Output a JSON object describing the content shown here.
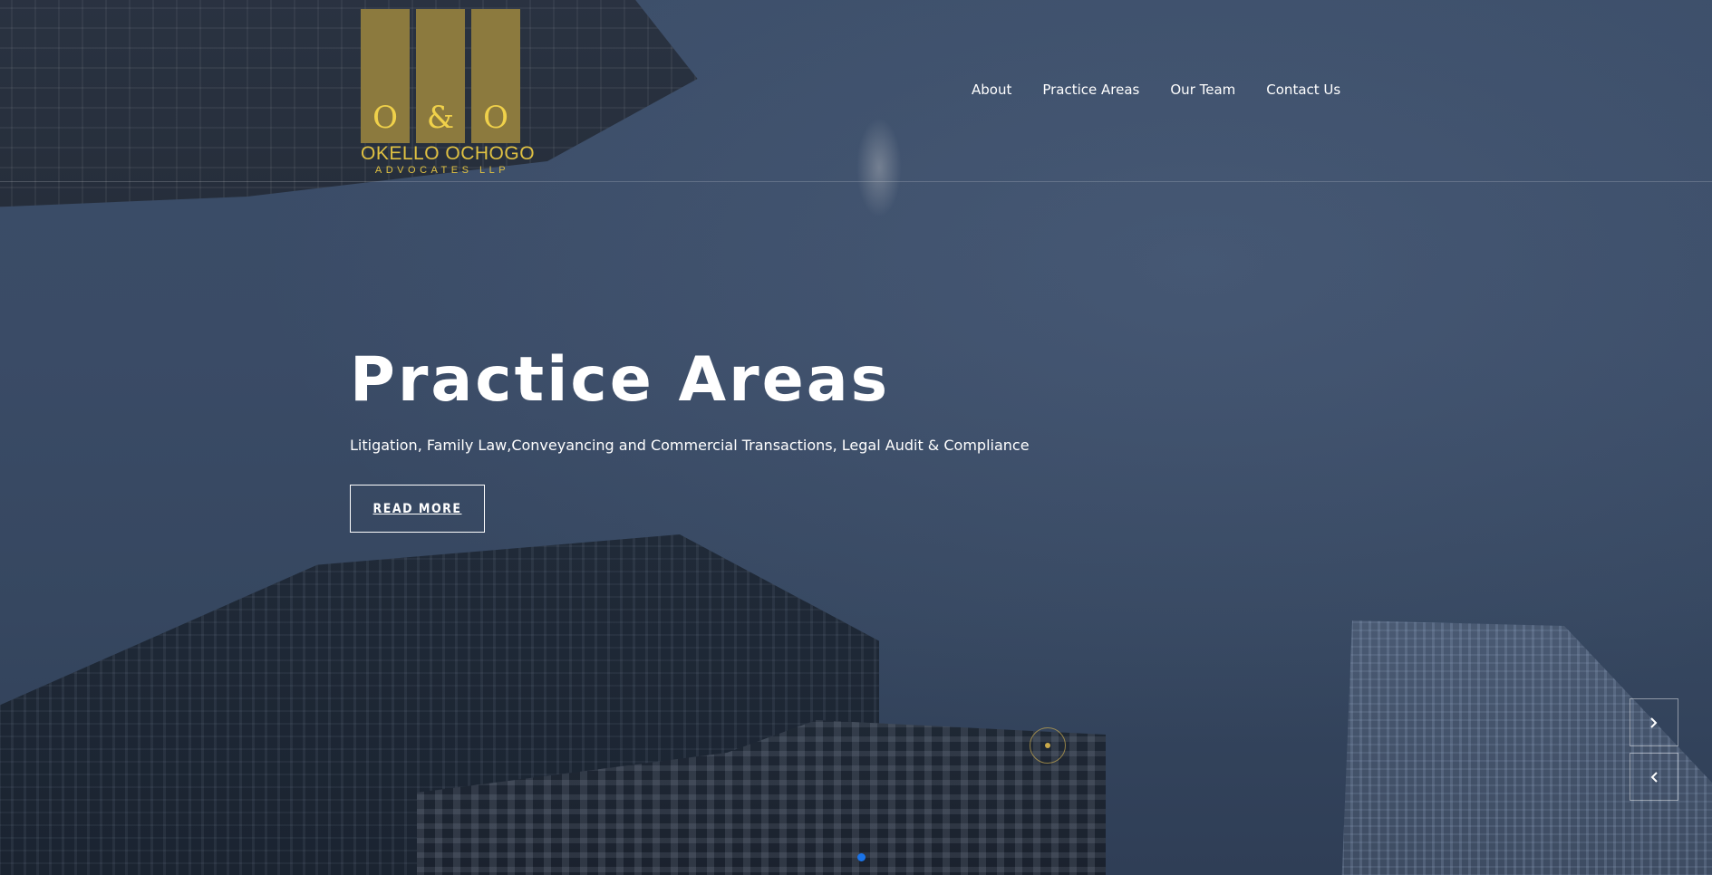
{
  "header": {
    "logo": {
      "letters": [
        "O",
        "&",
        "O"
      ],
      "name": "OKELLO OCHOGO",
      "subtitle": "ADVOCATES LLP",
      "bar_color": "#8c7a3e",
      "text_color": "#e0c142"
    },
    "nav": [
      {
        "label": "About"
      },
      {
        "label": "Practice Areas"
      },
      {
        "label": "Our Team"
      },
      {
        "label": "Contact Us"
      }
    ]
  },
  "hero": {
    "title": "Practice Areas",
    "subtitle": "Litigation, Family Law,Conveyancing and Commercial Transactions, Legal Audit & Compliance",
    "button_label": "READ MORE"
  },
  "slider": {
    "next_icon": "chevron-right-icon",
    "prev_icon": "chevron-left-icon",
    "active_dot_color": "#1a73e8"
  }
}
